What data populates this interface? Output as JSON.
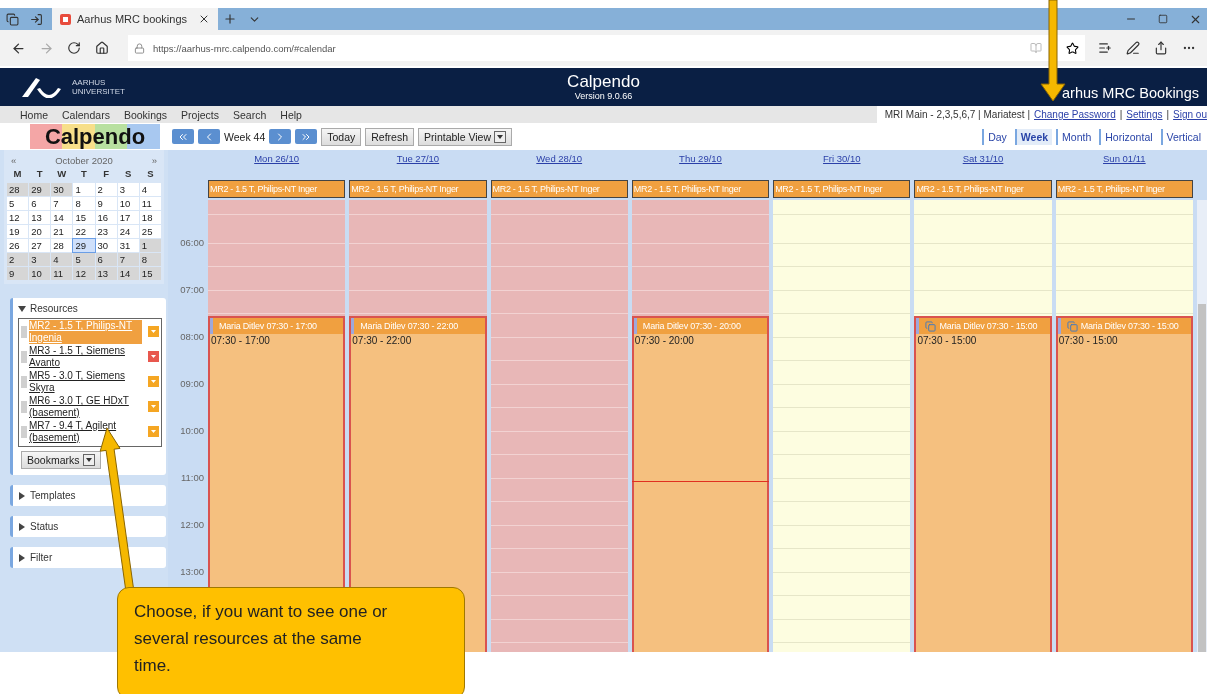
{
  "browser": {
    "tab_title": "Aarhus MRC bookings",
    "address": "https://aarhus-mrc.calpendo.com/#calendar"
  },
  "header": {
    "logo_line1": "AARHUS",
    "logo_line2": "UNIVERSITET",
    "app_name": "Calpendo",
    "version": "Version 9.0.66",
    "site_title": "arhus MRC Bookings"
  },
  "menu": [
    "Home",
    "Calendars",
    "Bookings",
    "Projects",
    "Search",
    "Help"
  ],
  "user_info": {
    "text": "MRI Main - 2,3,5,6,7 | Mariatest |",
    "separator": "|",
    "links": [
      "Change Password",
      "Settings",
      "Sign ou"
    ]
  },
  "toolbar": {
    "logo": "Calpendo",
    "week": "Week 44",
    "buttons": [
      "Today",
      "Refresh"
    ],
    "printable": "Printable View"
  },
  "views": [
    {
      "label": "Day",
      "selected": false
    },
    {
      "label": "Week",
      "selected": true
    },
    {
      "label": "Month",
      "selected": false
    },
    {
      "label": "Horizontal",
      "selected": false
    },
    {
      "label": "Vertical",
      "selected": false
    }
  ],
  "mini_calendar": {
    "prev": "«",
    "month": "October 2020",
    "next": "»",
    "weekdays": [
      "M",
      "T",
      "W",
      "T",
      "F",
      "S",
      "S"
    ],
    "weeks": [
      [
        {
          "d": "28",
          "muted": true,
          "selected": false
        },
        {
          "d": "29",
          "muted": true,
          "selected": false
        },
        {
          "d": "30",
          "muted": true,
          "selected": false
        },
        {
          "d": "1",
          "muted": false,
          "selected": false
        },
        {
          "d": "2",
          "muted": false,
          "selected": false
        },
        {
          "d": "3",
          "muted": false,
          "selected": false
        },
        {
          "d": "4",
          "muted": false,
          "selected": false
        }
      ],
      [
        {
          "d": "5",
          "muted": false,
          "selected": false
        },
        {
          "d": "6",
          "muted": false,
          "selected": false
        },
        {
          "d": "7",
          "muted": false,
          "selected": false
        },
        {
          "d": "8",
          "muted": false,
          "selected": false
        },
        {
          "d": "9",
          "muted": false,
          "selected": false
        },
        {
          "d": "10",
          "muted": false,
          "selected": false
        },
        {
          "d": "11",
          "muted": false,
          "selected": false
        }
      ],
      [
        {
          "d": "12",
          "muted": false,
          "selected": false
        },
        {
          "d": "13",
          "muted": false,
          "selected": false
        },
        {
          "d": "14",
          "muted": false,
          "selected": false
        },
        {
          "d": "15",
          "muted": false,
          "selected": false
        },
        {
          "d": "16",
          "muted": false,
          "selected": false
        },
        {
          "d": "17",
          "muted": false,
          "selected": false
        },
        {
          "d": "18",
          "muted": false,
          "selected": false
        }
      ],
      [
        {
          "d": "19",
          "muted": false,
          "selected": false
        },
        {
          "d": "20",
          "muted": false,
          "selected": false
        },
        {
          "d": "21",
          "muted": false,
          "selected": false
        },
        {
          "d": "22",
          "muted": false,
          "selected": false
        },
        {
          "d": "23",
          "muted": false,
          "selected": false
        },
        {
          "d": "24",
          "muted": false,
          "selected": false
        },
        {
          "d": "25",
          "muted": false,
          "selected": false
        }
      ],
      [
        {
          "d": "26",
          "muted": false,
          "selected": false
        },
        {
          "d": "27",
          "muted": false,
          "selected": false
        },
        {
          "d": "28",
          "muted": false,
          "selected": false
        },
        {
          "d": "29",
          "muted": false,
          "selected": true
        },
        {
          "d": "30",
          "muted": false,
          "selected": false
        },
        {
          "d": "31",
          "muted": false,
          "selected": false
        },
        {
          "d": "1",
          "muted": true,
          "selected": false
        }
      ],
      [
        {
          "d": "2",
          "muted": true,
          "selected": false
        },
        {
          "d": "3",
          "muted": true,
          "selected": false
        },
        {
          "d": "4",
          "muted": true,
          "selected": false
        },
        {
          "d": "5",
          "muted": true,
          "selected": false
        },
        {
          "d": "6",
          "muted": true,
          "selected": false
        },
        {
          "d": "7",
          "muted": true,
          "selected": false
        },
        {
          "d": "8",
          "muted": true,
          "selected": false
        }
      ],
      [
        {
          "d": "9",
          "muted": true,
          "selected": false
        },
        {
          "d": "10",
          "muted": true,
          "selected": false
        },
        {
          "d": "11",
          "muted": true,
          "selected": false
        },
        {
          "d": "12",
          "muted": true,
          "selected": false
        },
        {
          "d": "13",
          "muted": true,
          "selected": false
        },
        {
          "d": "14",
          "muted": true,
          "selected": false
        },
        {
          "d": "15",
          "muted": true,
          "selected": false
        }
      ]
    ]
  },
  "resources": {
    "title": "Resources",
    "expanded": true,
    "bookmarks": "Bookmarks",
    "items": [
      {
        "label": "MR2 - 1.5 T, Philips-NT Ingenia",
        "selected": true,
        "color": "#f5a623"
      },
      {
        "label": "MR3 - 1.5 T, Siemens Avanto",
        "selected": false,
        "color": "#e8574e"
      },
      {
        "label": "MR5 - 3.0 T, Siemens Skyra",
        "selected": false,
        "color": "#f5a623"
      },
      {
        "label": "MR6 - 3.0 T, GE HDxT (basement)",
        "selected": false,
        "color": "#f5a623"
      },
      {
        "label": "MR7 - 9.4 T, Agilent (basement)",
        "selected": false,
        "color": "#f5a623"
      }
    ]
  },
  "panels": [
    {
      "label": "Templates",
      "expanded": false
    },
    {
      "label": "Status",
      "expanded": false
    },
    {
      "label": "Filter",
      "expanded": false
    }
  ],
  "calendar": {
    "times": [
      "06:00",
      "07:00",
      "08:00",
      "09:00",
      "10:00",
      "11:00",
      "12:00",
      "13:00"
    ],
    "days": [
      {
        "label": "Mon 26/10",
        "resource": "MR2 - 1.5 T, Philips-NT Inger",
        "available": false,
        "now_line": false,
        "booking": {
          "title": "Maria Ditlev 07:30 - 17:00",
          "time": "07:30 - 17:00",
          "repeat": false
        }
      },
      {
        "label": "Tue 27/10",
        "resource": "MR2 - 1.5 T, Philips-NT Inger",
        "available": false,
        "now_line": false,
        "booking": {
          "title": "Maria Ditlev 07:30 - 22:00",
          "time": "07:30 - 22:00",
          "repeat": false
        }
      },
      {
        "label": "Wed 28/10",
        "resource": "MR2 - 1.5 T, Philips-NT Inger",
        "available": false,
        "now_line": false
      },
      {
        "label": "Thu 29/10",
        "resource": "MR2 - 1.5 T, Philips-NT Inger",
        "available": false,
        "now_line": true,
        "booking": {
          "title": "Maria Ditlev 07:30 - 20:00",
          "time": "07:30 - 20:00",
          "repeat": false
        }
      },
      {
        "label": "Fri 30/10",
        "resource": "MR2 - 1.5 T, Philips-NT Inger",
        "available": true,
        "now_line": false
      },
      {
        "label": "Sat 31/10",
        "resource": "MR2 - 1.5 T, Philips-NT Inger",
        "available": true,
        "now_line": false,
        "booking": {
          "title": "Maria Ditlev 07:30 - 15:00",
          "time": "07:30 - 15:00",
          "repeat": true
        }
      },
      {
        "label": "Sun 01/11",
        "resource": "MR2 - 1.5 T, Philips-NT Inger",
        "available": true,
        "now_line": false,
        "booking": {
          "title": "Maria Ditlev 07:30 - 15:00",
          "time": "07:30 - 15:00",
          "repeat": true
        }
      }
    ]
  },
  "callout": {
    "text": "Choose, if you want to see one or several resources at the same time."
  }
}
